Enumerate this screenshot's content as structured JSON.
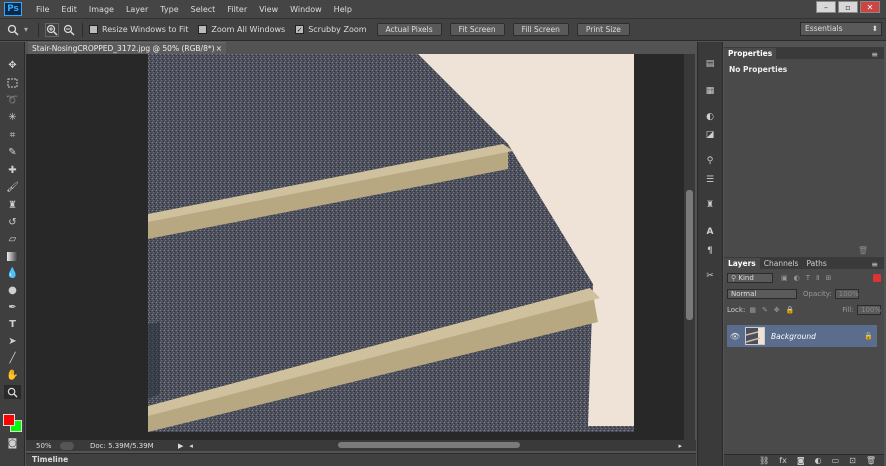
{
  "app": {
    "logo": "Ps"
  },
  "menu": [
    "File",
    "Edit",
    "Image",
    "Layer",
    "Type",
    "Select",
    "Filter",
    "View",
    "Window",
    "Help"
  ],
  "window_controls": {
    "minimize": "–",
    "restore": "▫",
    "close": "✕"
  },
  "options_bar": {
    "tool_icon": "zoom-icon",
    "zoom_in": "+",
    "zoom_out": "–",
    "resize_windows_label": "Resize Windows to Fit",
    "resize_windows_checked": false,
    "zoom_all_windows_label": "Zoom All Windows",
    "zoom_all_windows_checked": false,
    "scrubby_zoom_label": "Scrubby Zoom",
    "scrubby_zoom_checked": true,
    "buttons": [
      "Actual Pixels",
      "Fit Screen",
      "Fill Screen",
      "Print Size"
    ],
    "workspace": "Essentials"
  },
  "document": {
    "tab_title": "Stair-NosingCROPPED_3172.jpg @ 50% (RGB/8*)",
    "tab_close": "×",
    "zoom": "50%",
    "doc_info": "Doc: 5.39M/5.39M"
  },
  "timeline": {
    "label": "Timeline"
  },
  "properties": {
    "tab": "Properties",
    "content": "No Properties"
  },
  "layers_panel": {
    "tabs": [
      "Layers",
      "Channels",
      "Paths"
    ],
    "filter_kind": "Kind",
    "blend_mode": "Normal",
    "opacity_label": "Opacity:",
    "opacity_value": "100%",
    "lock_label": "Lock:",
    "fill_label": "Fill:",
    "fill_value": "100%",
    "layers": [
      {
        "name": "Background",
        "visible": true,
        "locked": true
      }
    ]
  },
  "colors": {
    "foreground": "#ff0000",
    "background": "#00ff00",
    "accent": "#5a6d8c"
  }
}
